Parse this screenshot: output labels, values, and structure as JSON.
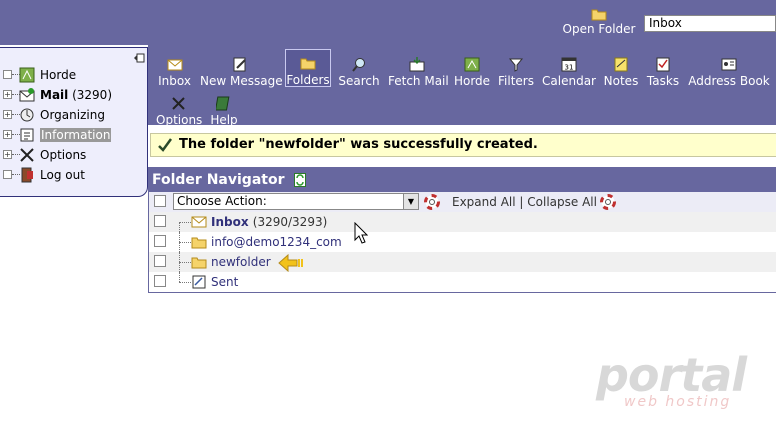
{
  "topbar": {
    "open_folder_label": "Open Folder",
    "folder_select_value": "Inbox"
  },
  "toolbar": {
    "items": [
      {
        "label": "Inbox",
        "icon": "inbox-icon"
      },
      {
        "label": "New Message",
        "icon": "new-message-icon"
      },
      {
        "label": "Folders",
        "icon": "folders-icon",
        "active": true
      },
      {
        "label": "Search",
        "icon": "search-icon"
      },
      {
        "label": "Fetch Mail",
        "icon": "fetch-mail-icon"
      },
      {
        "label": "Horde",
        "icon": "horde-icon"
      },
      {
        "label": "Filters",
        "icon": "filter-icon"
      },
      {
        "label": "Calendar",
        "icon": "calendar-icon"
      },
      {
        "label": "Notes",
        "icon": "notes-icon"
      },
      {
        "label": "Tasks",
        "icon": "tasks-icon"
      },
      {
        "label": "Address Book",
        "icon": "address-book-icon"
      },
      {
        "label": "Options",
        "icon": "options-icon"
      },
      {
        "label": "Help",
        "icon": "help-icon"
      }
    ],
    "calendar_day": "31"
  },
  "sidebar": {
    "items": [
      {
        "label": "Horde",
        "icon": "horde-icon"
      },
      {
        "label": "Mail",
        "count": "(3290)",
        "icon": "mail-icon"
      },
      {
        "label": "Organizing",
        "icon": "organizing-icon"
      },
      {
        "label": "Information",
        "icon": "information-icon",
        "selected": true
      },
      {
        "label": "Options",
        "icon": "options-icon"
      },
      {
        "label": "Log out",
        "icon": "logout-icon"
      }
    ]
  },
  "notification": {
    "message": "The folder \"newfolder\" was successfully created."
  },
  "navigator": {
    "title": "Folder Navigator",
    "action_select": "Choose Action:",
    "expand_all": "Expand All",
    "separator": "|",
    "collapse_all": "Collapse All",
    "folders": [
      {
        "name": "Inbox",
        "count": "(3290/3293)",
        "bold": true,
        "icon": "inbox-folder-icon"
      },
      {
        "name": "info@demo1234_com",
        "icon": "folder-icon"
      },
      {
        "name": "newfolder",
        "icon": "folder-icon"
      },
      {
        "name": "Sent",
        "icon": "sent-folder-icon"
      }
    ]
  },
  "watermark": {
    "brand": "portal",
    "sub": "web hosting"
  },
  "colors": {
    "bar": "#67679f",
    "sidebar_bg": "#eeeefc",
    "notify_bg": "#ffffcc",
    "link": "#31317a"
  }
}
